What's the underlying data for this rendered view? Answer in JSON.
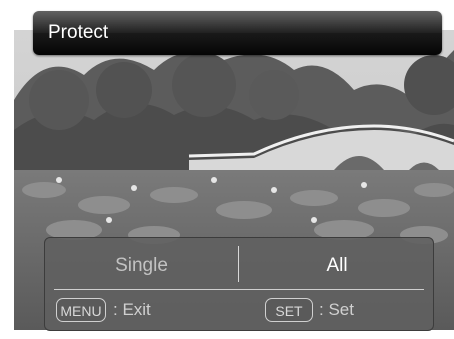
{
  "title_bar": {
    "title": "Protect"
  },
  "options": {
    "single": "Single",
    "all": "All",
    "selected": "All"
  },
  "hints": {
    "menu_key": "MENU",
    "exit": ": Exit",
    "set_key": "SET",
    "set": ": Set"
  },
  "colors": {
    "title_bar": "#1c1c1c",
    "panel": "#606060",
    "selected_text": "#ffffff",
    "unselected_text": "#c2c2c2"
  }
}
